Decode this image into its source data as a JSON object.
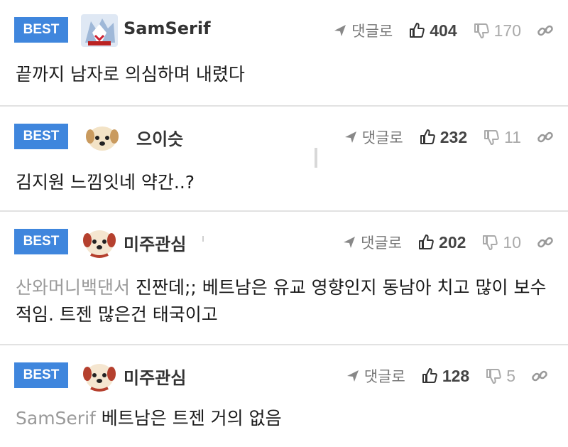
{
  "comments": [
    {
      "badge": "BEST",
      "username": "SamSerif",
      "avatar": "ice-creature-avatar",
      "reply_label": "댓글로",
      "upvotes": "404",
      "downvotes": "170",
      "mention": "",
      "text": "끝까지 남자로 의심하며 내렸다"
    },
    {
      "badge": "BEST",
      "username": "으이슷",
      "avatar": "puppy-avatar",
      "reply_label": "댓글로",
      "upvotes": "232",
      "downvotes": "11",
      "mention": "",
      "text": "김지원 느낌잇네 약간..?"
    },
    {
      "badge": "BEST",
      "username": "미주관심",
      "avatar": "puppy-red-avatar",
      "reply_label": "댓글로",
      "upvotes": "202",
      "downvotes": "10",
      "mention": "산와머니백댄서",
      "text": "진짠데;; 베트남은 유교 영향인지 동남아 치고 많이 보수적임. 트젠 많은건 태국이고"
    },
    {
      "badge": "BEST",
      "username": "미주관심",
      "avatar": "puppy-red-avatar",
      "reply_label": "댓글로",
      "upvotes": "128",
      "downvotes": "5",
      "mention": "SamSerif",
      "text": "베트남은 트젠 거의 없음"
    }
  ],
  "colors": {
    "best_badge": "#3f86dd",
    "divider": "#e2e2e2",
    "mention": "#9a9a9a"
  },
  "icons": [
    "reply-arrow-icon",
    "thumbs-up-icon",
    "thumbs-down-icon",
    "link-icon"
  ]
}
